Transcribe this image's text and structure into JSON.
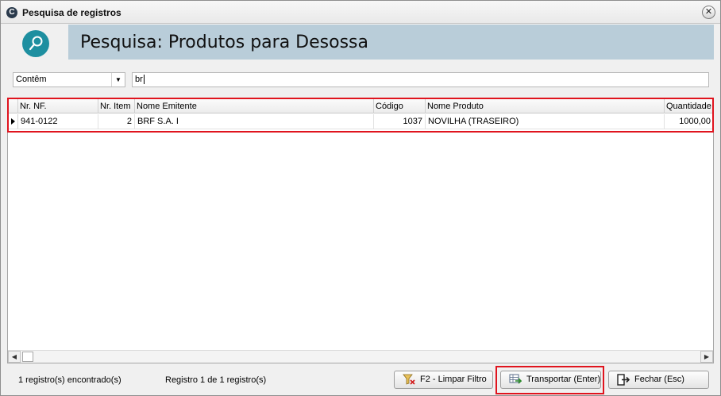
{
  "window": {
    "title": "Pesquisa de registros",
    "app_icon": "C",
    "close_glyph": "✕"
  },
  "header": {
    "title": "Pesquisa: Produtos para Desossa",
    "icon": "search-icon",
    "banner_color": "#b9cdd9",
    "icon_color": "#1e8fa0"
  },
  "filter": {
    "operator": "Contêm",
    "value": "br"
  },
  "grid": {
    "columns": [
      "Nr. NF.",
      "Nr. Item",
      "Nome Emitente",
      "Código",
      "Nome Produto",
      "Quantidade"
    ],
    "rows": [
      {
        "nr_nf": "941-0122",
        "nr_item": "2",
        "nome_emitente": "BRF S.A. I",
        "codigo": "1037",
        "nome_produto": "NOVILHA (TRASEIRO)",
        "quantidade": "1000,00"
      }
    ]
  },
  "status": {
    "count_text": "1 registro(s) encontrado(s)",
    "record_text": "Registro 1 de 1 registro(s)"
  },
  "buttons": {
    "clear_filter": "F2 - Limpar Filtro",
    "transport": "Transportar (Enter)",
    "close": "Fechar (Esc)"
  },
  "colors": {
    "highlight": "#e0141e"
  }
}
